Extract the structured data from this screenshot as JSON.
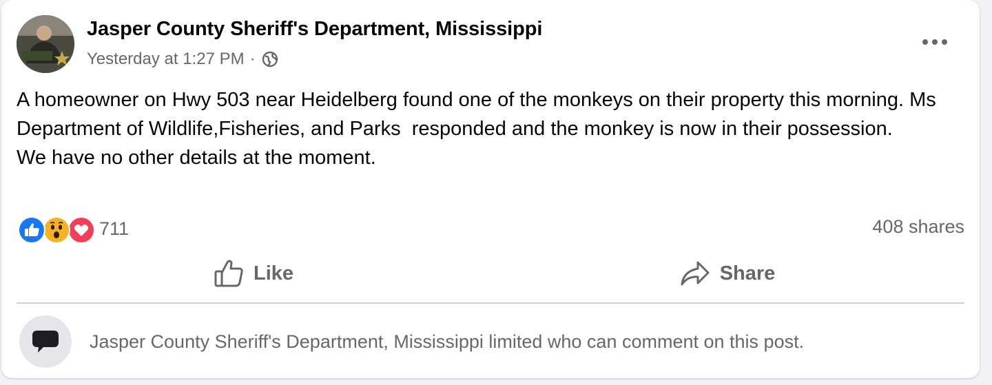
{
  "post": {
    "page_name": "Jasper County Sheriff's Department, Mississippi",
    "timestamp": "Yesterday at 1:27 PM",
    "separator": "·",
    "audience_icon": "globe-icon",
    "more_icon": "more-options-icon",
    "body": [
      "A homeowner on Hwy 503 near Heidelberg found one of the monkeys on their property this morning. Ms Department of Wildlife,Fisheries, and Parks  responded and the monkey is now in their possession.",
      "We have no other details at the moment."
    ]
  },
  "reactions": {
    "icons": [
      "like-reaction-icon",
      "wow-reaction-icon",
      "love-reaction-icon"
    ],
    "count": "711",
    "shares": "408 shares"
  },
  "actions": {
    "like_label": "Like",
    "share_label": "Share"
  },
  "comments": {
    "icon": "comment-bubble-icon",
    "notice": "Jasper County Sheriff's Department, Mississippi limited who can comment on this post."
  },
  "colors": {
    "card_bg": "#ffffff",
    "page_bg": "#f0f2f5",
    "secondary_text": "#65676b",
    "primary_text": "#050505",
    "like_blue": "#1877f2",
    "love_red": "#f33e58",
    "wow_yellow": "#f7b125"
  }
}
